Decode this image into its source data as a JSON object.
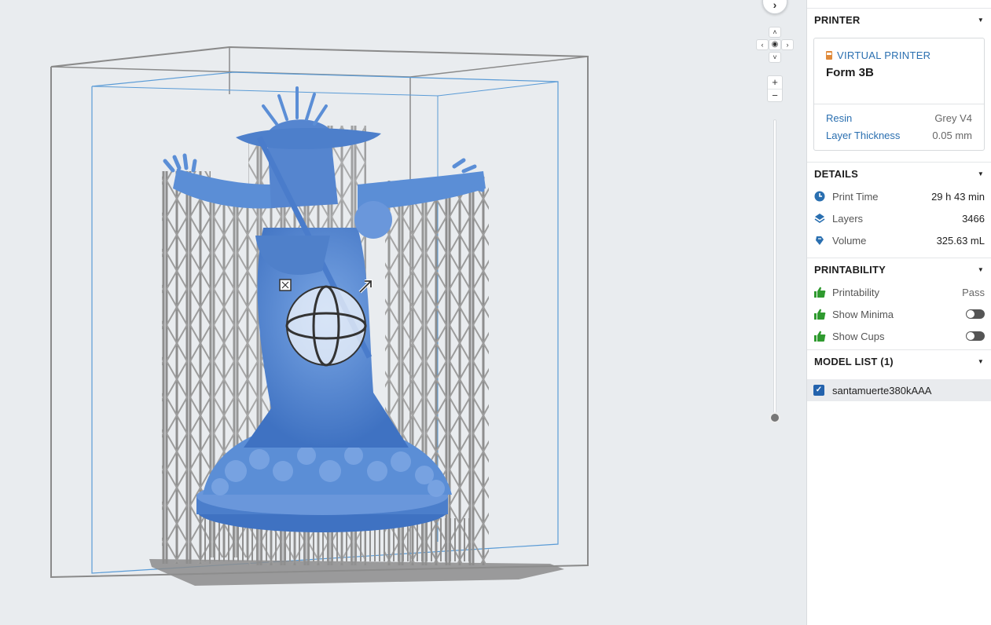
{
  "viewport": {
    "nav_next": "›",
    "nav_up": "˄",
    "nav_down": "˅",
    "nav_left": "‹",
    "nav_right": "›",
    "nav_center": "◉",
    "zoom_in": "+",
    "zoom_out": "−",
    "model_color": "#5b8ed6",
    "support_color": "#9a9a9a"
  },
  "printer": {
    "section_title": "PRINTER",
    "type_label": "VIRTUAL PRINTER",
    "model": "Form 3B",
    "resin_label": "Resin",
    "resin_value": "Grey V4",
    "layer_label": "Layer Thickness",
    "layer_value": "0.05 mm"
  },
  "details": {
    "section_title": "DETAILS",
    "items": [
      {
        "label": "Print Time",
        "value": "29 h 43 min",
        "icon": "clock-icon"
      },
      {
        "label": "Layers",
        "value": "3466",
        "icon": "layers-icon"
      },
      {
        "label": "Volume",
        "value": "325.63 mL",
        "icon": "resin-drop-icon"
      }
    ]
  },
  "printability": {
    "section_title": "PRINTABILITY",
    "items": [
      {
        "label": "Printability",
        "value": "Pass",
        "icon": "thumbs-up-icon"
      },
      {
        "label": "Show Minima",
        "toggle": false,
        "icon": "thumbs-up-icon"
      },
      {
        "label": "Show Cups",
        "toggle": false,
        "icon": "thumbs-up-icon"
      }
    ]
  },
  "model_list": {
    "section_title": "MODEL LIST (1)",
    "items": [
      {
        "name": "santamuerte380kAAA",
        "checked": true
      }
    ]
  },
  "colors": {
    "accent": "#2a6fb0",
    "pass_green": "#2f9a2f",
    "checkbox": "#2463ad"
  }
}
